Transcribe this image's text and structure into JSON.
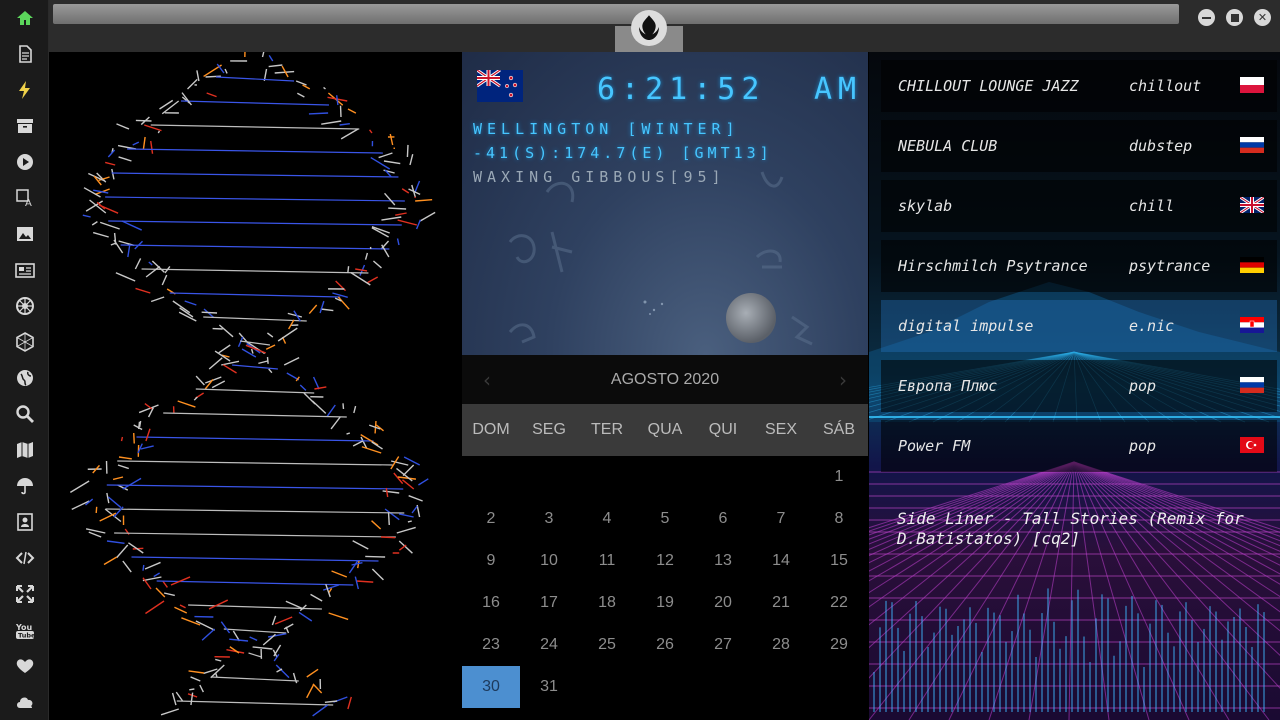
{
  "sidebar": {
    "items": [
      {
        "icon": "home-icon"
      },
      {
        "icon": "document-icon"
      },
      {
        "icon": "bolt-icon"
      },
      {
        "icon": "archive-icon"
      },
      {
        "icon": "play-icon"
      },
      {
        "icon": "translate-icon"
      },
      {
        "icon": "image-icon"
      },
      {
        "icon": "newspaper-icon"
      },
      {
        "icon": "empire-icon"
      },
      {
        "icon": "hexagon-icon"
      },
      {
        "icon": "globe-icon"
      },
      {
        "icon": "search-icon"
      },
      {
        "icon": "map-icon"
      },
      {
        "icon": "umbrella-icon"
      },
      {
        "icon": "contacts-icon"
      },
      {
        "icon": "code-icon"
      },
      {
        "icon": "expand-icon"
      },
      {
        "icon": "youtube-icon"
      },
      {
        "icon": "heart-icon"
      },
      {
        "icon": "cloud-icon"
      }
    ],
    "active_color": "#5cd65c"
  },
  "titlebar": {
    "logo_icon": "rebel-alliance-icon",
    "buttons": [
      "minimize-icon",
      "maximize-icon",
      "close-icon"
    ]
  },
  "clock": {
    "flag": "new-zealand-flag",
    "time": "6:21:52",
    "ampm": "AM",
    "city": "WELLINGTON [WINTER]",
    "coords": "-41(S):174.7(E) [GMT13]",
    "moon_phase": "WAXING GIBBOUS[95]"
  },
  "calendar": {
    "title": "AGOSTO 2020",
    "prev": "‹",
    "next": "›",
    "weekdays": [
      "DOM",
      "SEG",
      "TER",
      "QUA",
      "QUI",
      "SEX",
      "SÁB"
    ],
    "days": [
      "",
      "",
      "",
      "",
      "",
      "",
      "1",
      "2",
      "3",
      "4",
      "5",
      "6",
      "7",
      "8",
      "9",
      "10",
      "11",
      "12",
      "13",
      "14",
      "15",
      "16",
      "17",
      "18",
      "19",
      "20",
      "21",
      "22",
      "23",
      "24",
      "25",
      "26",
      "27",
      "28",
      "29",
      "30",
      "31",
      "",
      "",
      "",
      "",
      ""
    ],
    "today": "30",
    "today_color": "#4c8fd0"
  },
  "radio": {
    "stations": [
      {
        "name": "CHILLOUT LOUNGE JAZZ",
        "genre": "chillout",
        "flag": "poland-flag"
      },
      {
        "name": "NEBULA CLUB",
        "genre": "dubstep",
        "flag": "russia-flag"
      },
      {
        "name": "skylab",
        "genre": "chill",
        "flag": "uk-flag"
      },
      {
        "name": "Hirschmilch Psytrance",
        "genre": "psytrance",
        "flag": "germany-flag"
      },
      {
        "name": "digital impulse",
        "genre": "e.nic",
        "flag": "croatia-flag"
      },
      {
        "name": "Европа Плюс",
        "genre": "pop",
        "flag": "russia-flag"
      },
      {
        "name": "Power FM",
        "genre": "pop",
        "flag": "turkey-flag"
      }
    ],
    "active_index": 4,
    "now_playing": "Side Liner - Tall Stories (Remix for D.Batistatos) [cq2]"
  }
}
